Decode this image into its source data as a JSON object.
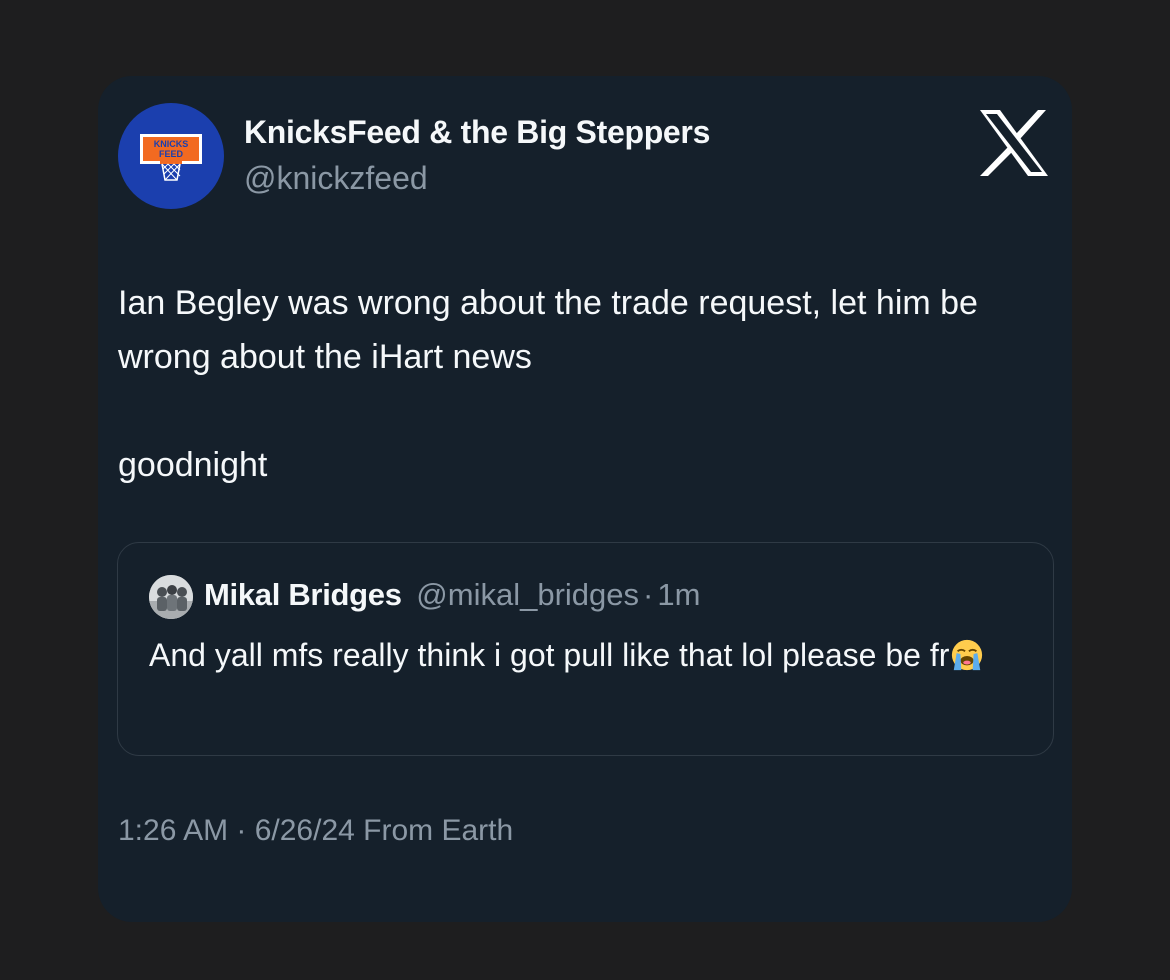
{
  "tweet": {
    "author_name": "KnicksFeed & the Big Steppers",
    "author_handle": "@knickzfeed",
    "avatar_logo_text": [
      "KNICKS",
      "FEED"
    ],
    "text_lines": [
      "Ian Begley was wrong about the trade request, let him be wrong about the iHart news",
      "goodnight"
    ],
    "timestamp": "1:26 AM · 6/26/24 From Earth",
    "platform_icon": "x-logo-icon"
  },
  "quote": {
    "author_name": "Mikal Bridges",
    "author_handle": "@mikal_bridges",
    "separator": "·",
    "time_ago": "1m",
    "text": "And yall mfs really think i got pull like that lol please be fr",
    "emoji": "loudly-crying-face-icon"
  },
  "colors": {
    "background": "#1e1e1f",
    "card": "#15202b",
    "primary_text": "#f5f8fa",
    "secondary_text": "#8b98a5",
    "avatar_blue": "#1b3fae",
    "logo_orange": "#f26a21"
  }
}
